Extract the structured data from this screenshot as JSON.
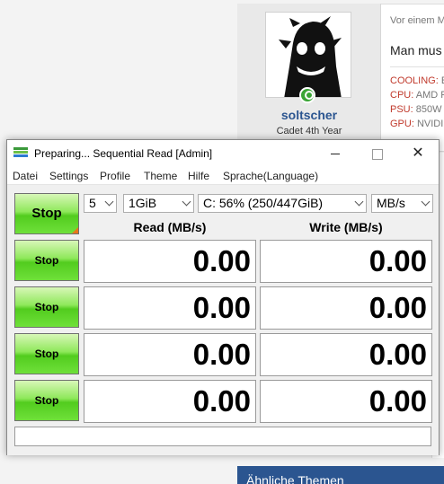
{
  "background": {
    "username": "soltscher",
    "user_title": "Cadet 4th Year",
    "post_meta": "Vor einem M",
    "post_text": "Man mus",
    "specs": [
      {
        "key": "COOLING:",
        "value": " E"
      },
      {
        "key": "CPU:",
        "value": " AMD R"
      },
      {
        "key": "PSU:",
        "value": " 850W"
      },
      {
        "key": "GPU:",
        "value": " NVIDI"
      }
    ],
    "similar_threads_label": "Ähnliche Themen"
  },
  "window": {
    "title": "Preparing... Sequential Read [Admin]",
    "close_glyph": "✕"
  },
  "menu": [
    "Datei",
    "Settings",
    "Profile",
    "Theme",
    "Hilfe",
    "Sprache(Language)"
  ],
  "controls": {
    "main_button": "Stop",
    "count": "5",
    "size": "1GiB",
    "drive": "C: 56% (250/447GiB)",
    "unit": "MB/s"
  },
  "headers": {
    "read": "Read (MB/s)",
    "write": "Write (MB/s)"
  },
  "rows": [
    {
      "button": "Stop",
      "read": "0.00",
      "write": "0.00"
    },
    {
      "button": "Stop",
      "read": "0.00",
      "write": "0.00"
    },
    {
      "button": "Stop",
      "read": "0.00",
      "write": "0.00"
    },
    {
      "button": "Stop",
      "read": "0.00",
      "write": "0.00"
    }
  ],
  "comment": "",
  "colors": {
    "button_green": "#52cc1e",
    "link_blue": "#2b5590",
    "spec_red": "#c0392b"
  }
}
